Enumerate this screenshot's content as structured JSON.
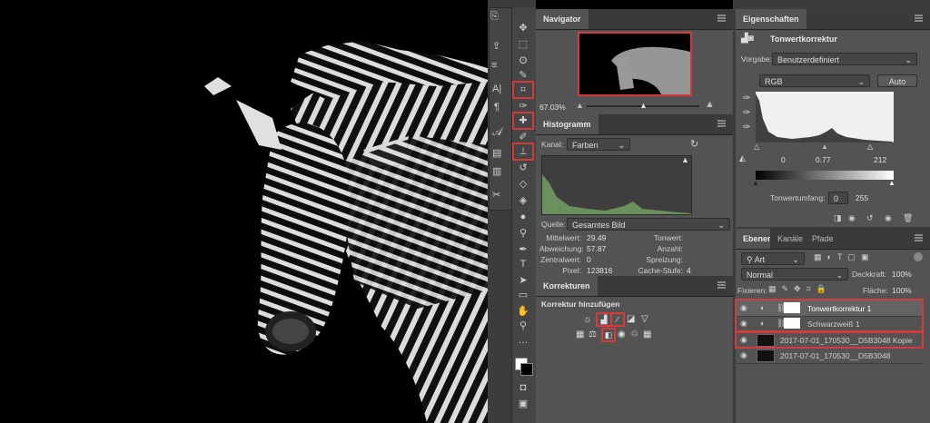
{
  "navigator": {
    "tab": "Navigator",
    "zoom": "67.03%"
  },
  "histogram": {
    "tab": "Histogramm",
    "channel_label": "Kanal:",
    "channel_value": "Farben",
    "source_label": "Quelle:",
    "source_value": "Gesamtes Bild",
    "stats_left": [
      {
        "label": "Mittelwert:",
        "value": "29.49"
      },
      {
        "label": "Abweichung:",
        "value": "57.87"
      },
      {
        "label": "Zentralwert:",
        "value": "0"
      },
      {
        "label": "Pixel:",
        "value": "123816"
      }
    ],
    "stats_right": [
      {
        "label": "Tonwert:",
        "value": ""
      },
      {
        "label": "Anzahl:",
        "value": ""
      },
      {
        "label": "Spreizung:",
        "value": ""
      },
      {
        "label": "Cache-Stufe:",
        "value": "4"
      }
    ]
  },
  "corrections": {
    "tab": "Korrekturen",
    "subtitle": "Korrektur hinzufügen"
  },
  "properties": {
    "tab": "Eigenschaften",
    "title": "Tonwertkorrektur",
    "preset_label": "Vorgabe:",
    "preset_value": "Benutzerdefiniert",
    "channel_value": "RGB",
    "auto_label": "Auto",
    "input_black": "0",
    "input_gamma": "0.77",
    "input_white": "212",
    "output_label": "Tonwertumfang:",
    "output_black": "0",
    "output_white": "255"
  },
  "layers_panel": {
    "tabs": [
      "Ebenen",
      "Kanäle",
      "Pfade"
    ],
    "filter_value": "Art",
    "blend_mode": "Normal",
    "opacity_label": "Deckkraft:",
    "opacity_value": "100%",
    "lock_label": "Fixieren:",
    "fill_label": "Fläche:",
    "fill_value": "100%",
    "layers": [
      {
        "name": "Tonwertkorrektur 1"
      },
      {
        "name": "Schwarzweiß 1"
      },
      {
        "name": "2017-07-01_170530__D5B3048 Kopie"
      },
      {
        "name": "2017-07-01_170530__D5B3048"
      }
    ]
  },
  "colors": {
    "panel": "#535353",
    "highlight": "#d43b3b",
    "histogram": "#6c8f5e"
  }
}
